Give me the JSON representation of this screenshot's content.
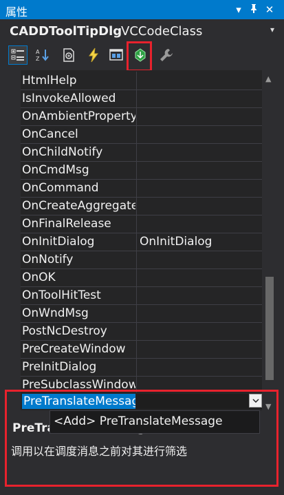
{
  "window": {
    "title": "属性",
    "dropdown_glyph": "▾",
    "pin_glyph": "Ꝑ",
    "close_glyph": "✕"
  },
  "object": {
    "name": "CADDToolTipDlg",
    "type": "VCCodeClass",
    "dropdown_glyph": "▾"
  },
  "toolbar": {
    "tools": [
      {
        "name": "categorized",
        "icon": "categorized-icon"
      },
      {
        "name": "alphabetical",
        "icon": "alphabetical-icon"
      },
      {
        "name": "properties",
        "icon": "properties-icon"
      },
      {
        "name": "events",
        "icon": "events-lightning-icon"
      },
      {
        "name": "messages",
        "icon": "messages-icon"
      },
      {
        "name": "overrides",
        "icon": "overrides-icon"
      },
      {
        "name": "property-pages",
        "icon": "wrench-icon"
      }
    ],
    "highlight_color": "#e8222d"
  },
  "grid": {
    "rows": [
      {
        "name": "HtmlHelp",
        "value": ""
      },
      {
        "name": "IsInvokeAllowed",
        "value": ""
      },
      {
        "name": "OnAmbientProperty",
        "value": ""
      },
      {
        "name": "OnCancel",
        "value": ""
      },
      {
        "name": "OnChildNotify",
        "value": ""
      },
      {
        "name": "OnCmdMsg",
        "value": ""
      },
      {
        "name": "OnCommand",
        "value": ""
      },
      {
        "name": "OnCreateAggregates",
        "value": ""
      },
      {
        "name": "OnFinalRelease",
        "value": ""
      },
      {
        "name": "OnInitDialog",
        "value": "OnInitDialog"
      },
      {
        "name": "OnNotify",
        "value": ""
      },
      {
        "name": "OnOK",
        "value": ""
      },
      {
        "name": "OnToolHitTest",
        "value": ""
      },
      {
        "name": "OnWndMsg",
        "value": ""
      },
      {
        "name": "PostNcDestroy",
        "value": ""
      },
      {
        "name": "PreCreateWindow",
        "value": ""
      },
      {
        "name": "PreInitDialog",
        "value": ""
      },
      {
        "name": "PreSubclassWindow",
        "value": ""
      }
    ],
    "selected": {
      "name": "PreTranslateMessage",
      "value": ""
    }
  },
  "dropdown": {
    "option": "<Add> PreTranslateMessage"
  },
  "description": {
    "title": "PreTranslateMessage",
    "text": "调用以在调度消息之前对其进行筛选"
  },
  "colors": {
    "accent": "#007acc",
    "background": "#2d2d30",
    "highlight": "#e8222d"
  }
}
